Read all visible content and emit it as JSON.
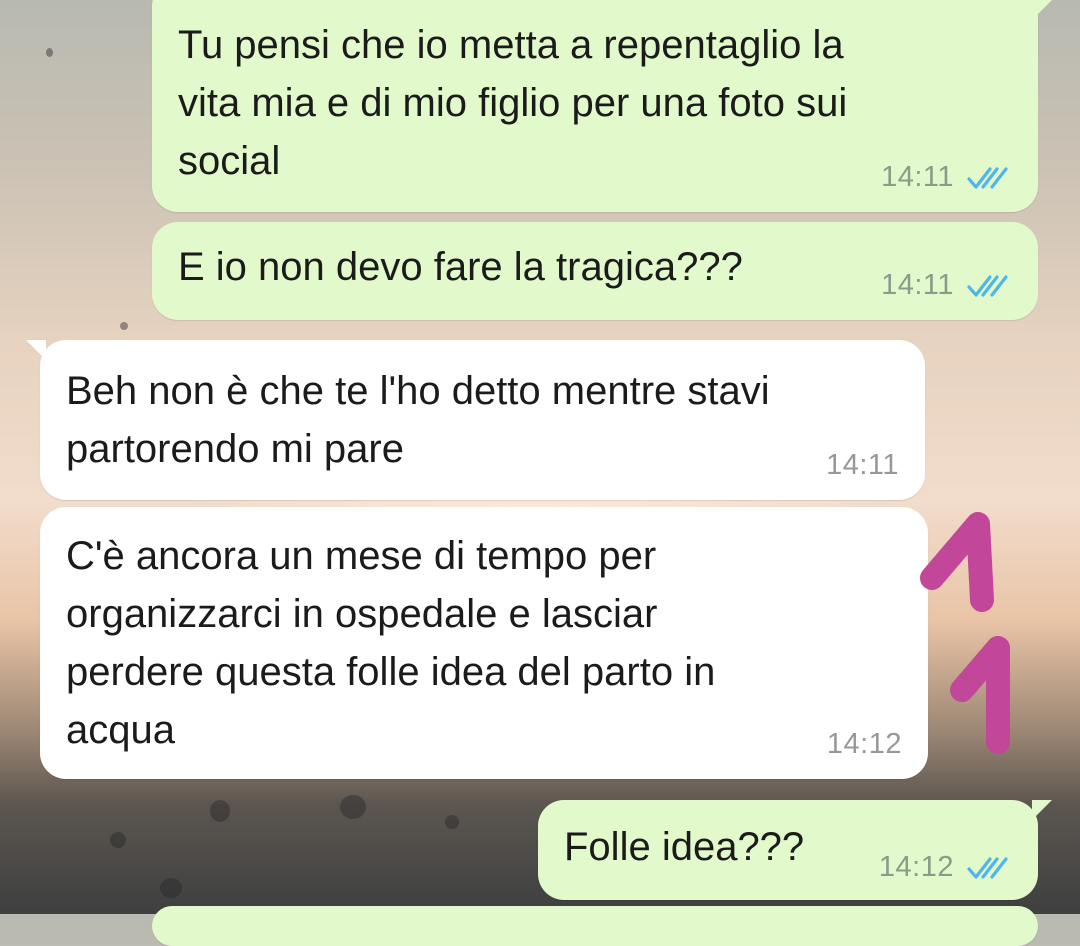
{
  "messages": [
    {
      "direction": "out",
      "text": "Tu pensi che io metta a repentaglio la\nvita mia e di mio figlio per una foto sui\nsocial",
      "time": "14:11",
      "status": "read"
    },
    {
      "direction": "out",
      "text": "E io non devo fare la tragica???",
      "time": "14:11",
      "status": "read"
    },
    {
      "direction": "in",
      "text": "Beh non è che te l'ho detto mentre stavi\npartorendo mi pare",
      "time": "14:11"
    },
    {
      "direction": "in",
      "text": "C'è ancora un mese di tempo per\norganizzarci in ospedale e lasciar\nperdere questa folle idea del parto in\nacqua",
      "time": "14:12"
    },
    {
      "direction": "out",
      "text": "Folle idea???",
      "time": "14:12",
      "status": "read"
    }
  ],
  "icons": {
    "read_receipt": "double-check-icon"
  },
  "colors": {
    "outgoing_bubble": "#e2f9cc",
    "incoming_bubble": "#ffffff",
    "read_tick": "#4fb6ec",
    "annotation": "#c2479a"
  }
}
